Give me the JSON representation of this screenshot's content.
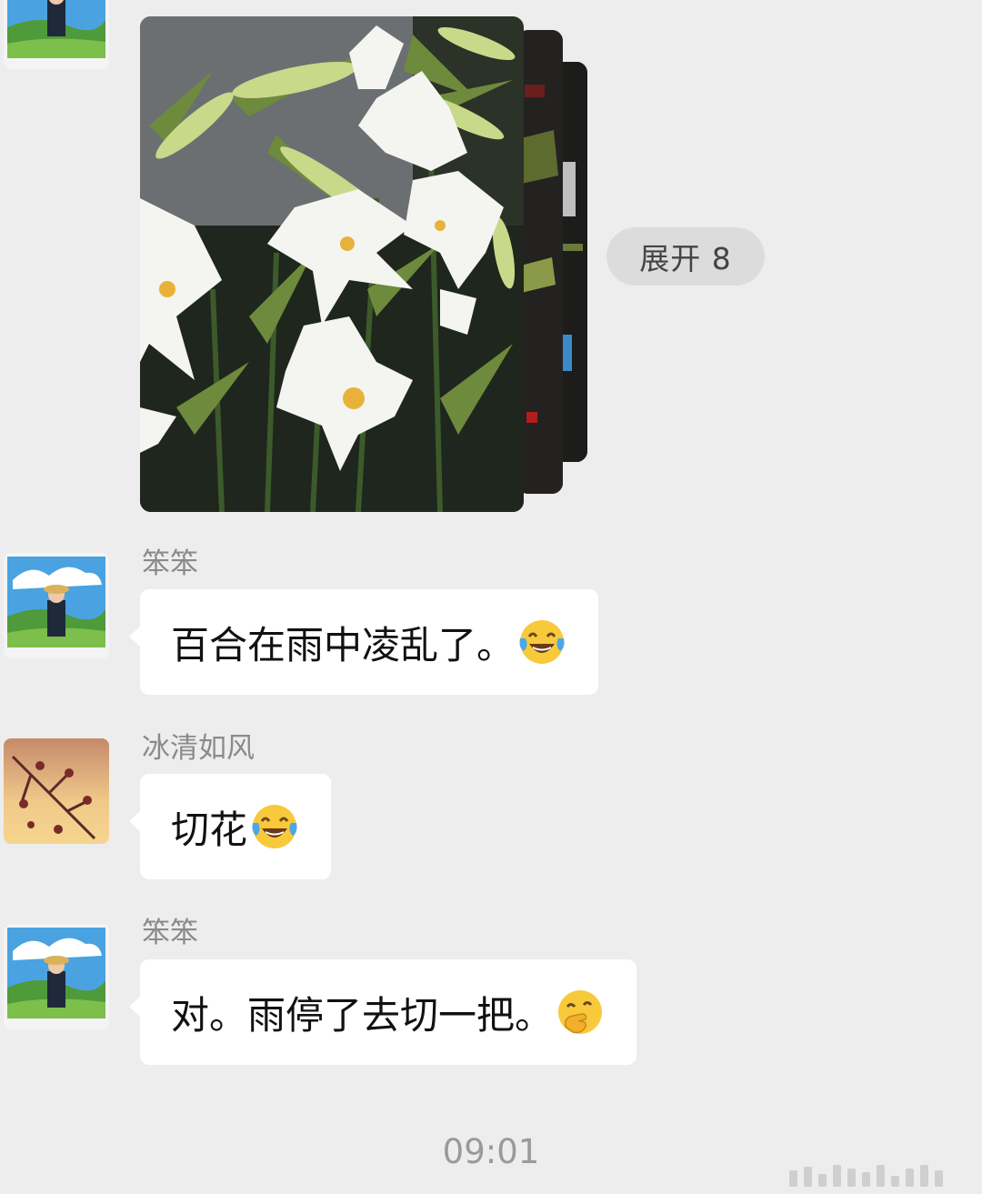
{
  "chat": {
    "expand_label": "展开 8",
    "messages": [
      {
        "sender": "笨笨",
        "text": "百合在雨中凌乱了。",
        "emoji": "tears-of-joy-emoji"
      },
      {
        "sender": "冰清如风",
        "text": "切花",
        "emoji": "tears-of-joy-emoji"
      },
      {
        "sender": "笨笨",
        "text": "对。雨停了去切一把。",
        "emoji": "hand-over-mouth-emoji"
      }
    ],
    "timestamp": "09:01"
  },
  "colors": {
    "background": "#ededed",
    "bubble": "#ffffff",
    "name_text": "#8a8a8a",
    "timestamp": "#9a9a9a"
  }
}
